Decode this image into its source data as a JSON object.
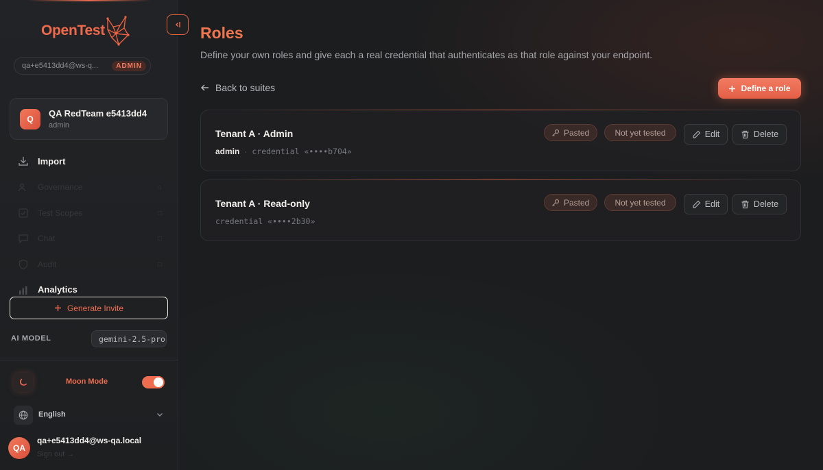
{
  "sidebar": {
    "logo_text": "OpenTest",
    "user_pill": {
      "email": "qa+e5413dd4@ws-q...",
      "badge": "ADMIN"
    },
    "workspace": {
      "initial": "Q",
      "name": "QA RedTeam e5413dd4",
      "role": "admin"
    },
    "nav": [
      {
        "label": "Import",
        "icon": "download-icon",
        "active": true
      },
      {
        "label": "Governance",
        "icon": "people-icon",
        "trail": "⌂"
      },
      {
        "label": "Test Scopes",
        "icon": "check-icon",
        "trail": "□"
      },
      {
        "label": "Chat",
        "icon": "chat-icon",
        "trail": "□"
      },
      {
        "label": "Audit",
        "icon": "shield-icon",
        "trail": "□"
      },
      {
        "label": "Analytics",
        "icon": "chart-icon",
        "active": true
      }
    ],
    "generate_invite": "Generate Invite",
    "ai_model": {
      "label": "AI MODEL",
      "value": "gemini-2.5-pro"
    },
    "moon_mode": {
      "label": "Moon Mode",
      "enabled": true
    },
    "language": "English",
    "footer": {
      "initials": "QA",
      "email": "qa+e5413dd4@ws-qa.local",
      "signout": "Sign out →"
    }
  },
  "main": {
    "title": "Roles",
    "subtitle": "Define your own roles and give each a real credential that authenticates as that role against your endpoint.",
    "back_label": "Back to suites",
    "define_button": "Define a role",
    "roles": [
      {
        "title": "Tenant A · Admin",
        "role_name": "admin",
        "credential": "credential «••••b704»",
        "source": "Pasted",
        "status": "Not yet tested",
        "edit": "Edit",
        "delete": "Delete"
      },
      {
        "title": "Tenant A · Read-only",
        "role_name": "",
        "credential": "credential «••••2b30»",
        "source": "Pasted",
        "status": "Not yet tested",
        "edit": "Edit",
        "delete": "Delete"
      }
    ]
  },
  "colors": {
    "accent": "#ef6d50",
    "background": "#1c1d1f",
    "sidebar": "#212326"
  }
}
